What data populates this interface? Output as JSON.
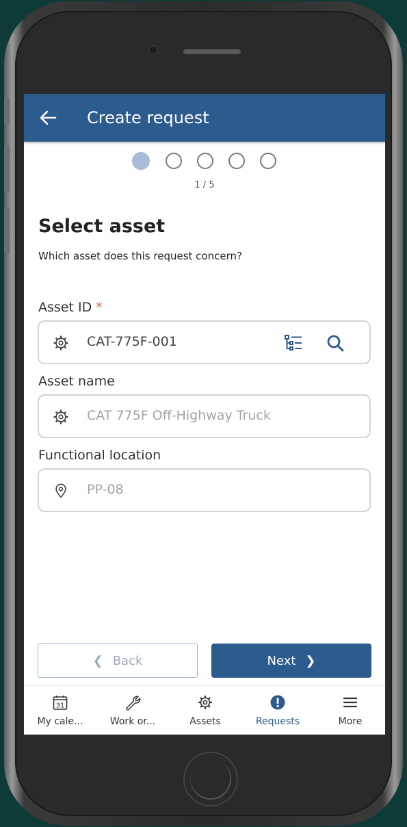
{
  "header": {
    "title": "Create request"
  },
  "stepper": {
    "current": 1,
    "total": 5,
    "label": "1 / 5"
  },
  "section": {
    "title": "Select asset",
    "subtitle": "Which asset does this request concern?"
  },
  "fields": {
    "asset_id": {
      "label": "Asset ID",
      "required_mark": "*",
      "value": "CAT-775F-001"
    },
    "asset_name": {
      "label": "Asset name",
      "value": "CAT 775F Off-Highway Truck"
    },
    "functional_location": {
      "label": "Functional location",
      "value": "PP-08"
    }
  },
  "buttons": {
    "back": "Back",
    "next": "Next"
  },
  "nav": {
    "items": [
      {
        "label": "My cale...",
        "icon": "calendar-icon",
        "badge": "31"
      },
      {
        "label": "Work or...",
        "icon": "wrench-icon"
      },
      {
        "label": "Assets",
        "icon": "gear-icon"
      },
      {
        "label": "Requests",
        "icon": "exclamation-circle-icon",
        "active": true
      },
      {
        "label": "More",
        "icon": "menu-icon"
      }
    ]
  },
  "colors": {
    "primary": "#2c5b8e",
    "required": "#e06a4a",
    "dot_active": "#a8bcd7"
  }
}
